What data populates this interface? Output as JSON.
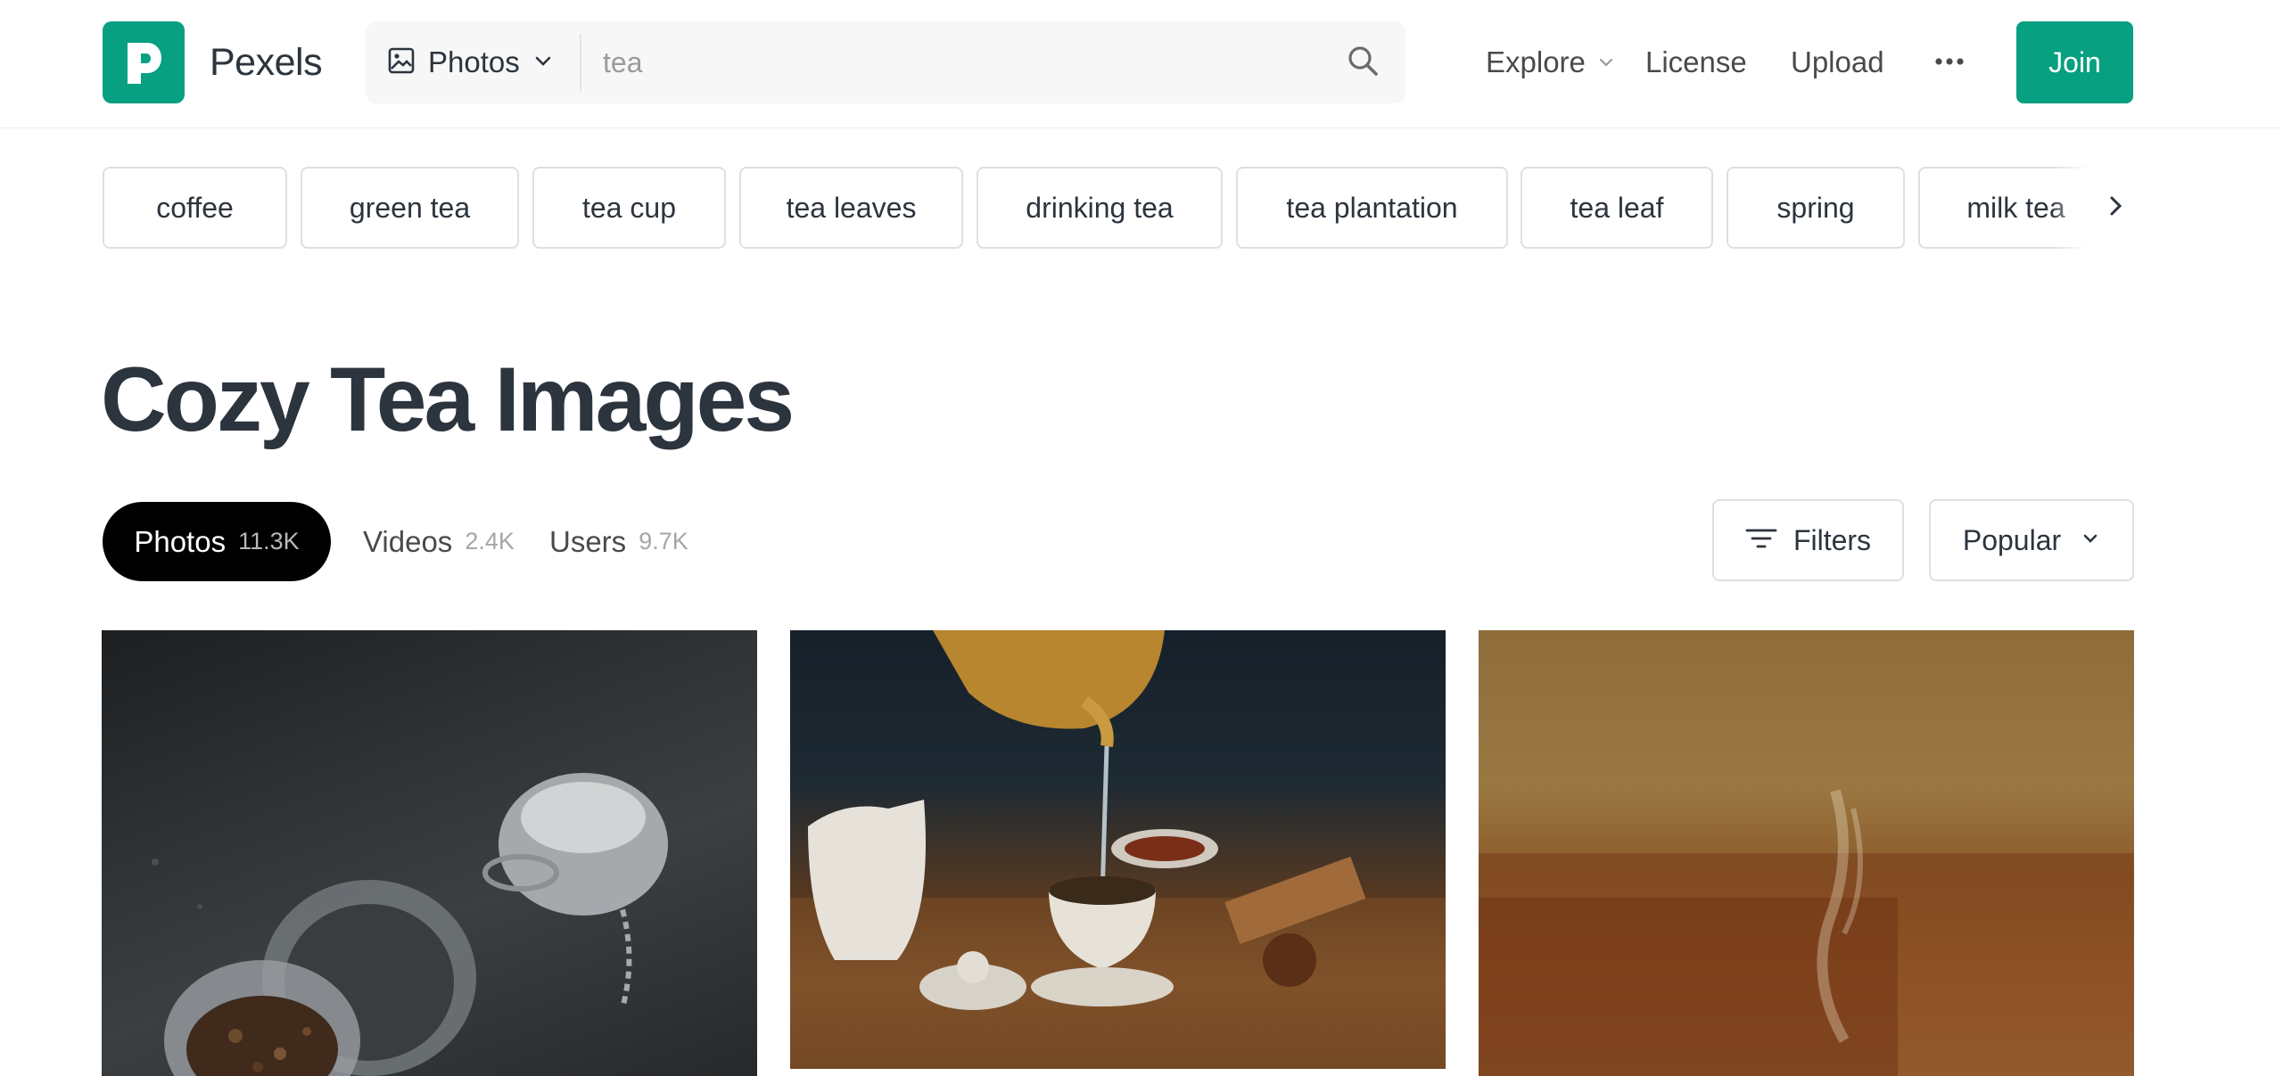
{
  "header": {
    "brand": "Pexels",
    "search": {
      "media_type": "Photos",
      "value": "",
      "placeholder": "tea"
    },
    "nav": {
      "explore": "Explore",
      "license": "License",
      "upload": "Upload"
    },
    "join_label": "Join"
  },
  "related_searches": [
    "coffee",
    "green tea",
    "tea cup",
    "tea leaves",
    "drinking tea",
    "tea plantation",
    "tea leaf",
    "spring",
    "milk tea"
  ],
  "title": "Cozy Tea Images",
  "tabs": [
    {
      "label": "Photos",
      "count": "11.3K",
      "active": true
    },
    {
      "label": "Videos",
      "count": "2.4K",
      "active": false
    },
    {
      "label": "Users",
      "count": "9.7K",
      "active": false
    }
  ],
  "filters_label": "Filters",
  "sort": {
    "selected": "Popular"
  },
  "colors": {
    "brand": "#07a081",
    "text": "#2c343e",
    "active_tab": "#000000"
  },
  "icons": {
    "search": "search-icon",
    "photo": "image-icon",
    "more": "more-horizontal-icon",
    "next": "chevron-right-icon",
    "filters": "filter-lines-icon"
  }
}
